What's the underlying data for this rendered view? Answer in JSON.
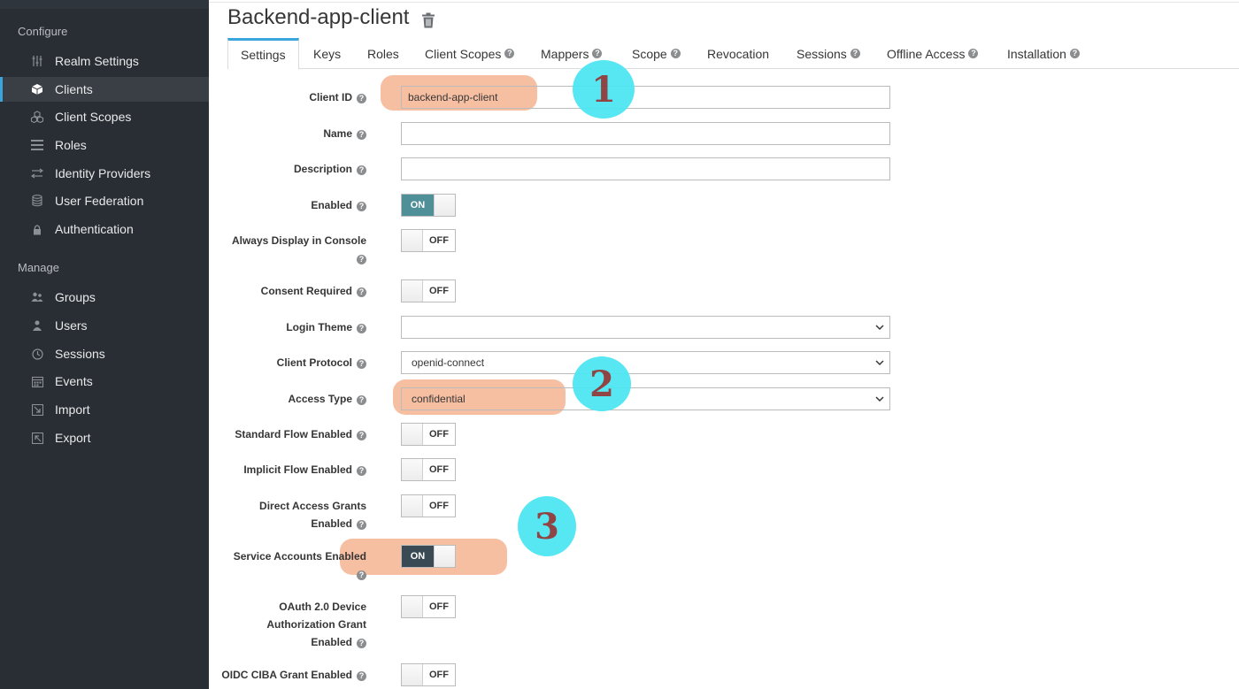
{
  "sidebar": {
    "configure_label": "Configure",
    "manage_label": "Manage",
    "configure_items": [
      {
        "label": "Realm Settings",
        "icon": "sliders-icon"
      },
      {
        "label": "Clients",
        "icon": "cube-icon"
      },
      {
        "label": "Client Scopes",
        "icon": "cubes-icon"
      },
      {
        "label": "Roles",
        "icon": "list-icon"
      },
      {
        "label": "Identity Providers",
        "icon": "exchange-icon"
      },
      {
        "label": "User Federation",
        "icon": "database-icon"
      },
      {
        "label": "Authentication",
        "icon": "lock-icon"
      }
    ],
    "manage_items": [
      {
        "label": "Groups",
        "icon": "users-icon"
      },
      {
        "label": "Users",
        "icon": "user-icon"
      },
      {
        "label": "Sessions",
        "icon": "clock-icon"
      },
      {
        "label": "Events",
        "icon": "calendar-icon"
      },
      {
        "label": "Import",
        "icon": "import-icon"
      },
      {
        "label": "Export",
        "icon": "export-icon"
      }
    ],
    "active_item": "Clients"
  },
  "header": {
    "title": "Backend-app-client"
  },
  "tabs": [
    {
      "label": "Settings",
      "help": false,
      "active": true
    },
    {
      "label": "Keys",
      "help": false
    },
    {
      "label": "Roles",
      "help": false
    },
    {
      "label": "Client Scopes",
      "help": true
    },
    {
      "label": "Mappers",
      "help": true
    },
    {
      "label": "Scope",
      "help": true
    },
    {
      "label": "Revocation",
      "help": false
    },
    {
      "label": "Sessions",
      "help": true
    },
    {
      "label": "Offline Access",
      "help": true
    },
    {
      "label": "Installation",
      "help": true
    }
  ],
  "form": {
    "client_id": {
      "label": "Client ID",
      "value": "backend-app-client"
    },
    "name": {
      "label": "Name",
      "value": ""
    },
    "description": {
      "label": "Description",
      "value": ""
    },
    "enabled": {
      "label": "Enabled",
      "state": "ON"
    },
    "always_display": {
      "label_line1": "Always Display in Console",
      "state": "OFF"
    },
    "consent_required": {
      "label": "Consent Required",
      "state": "OFF"
    },
    "login_theme": {
      "label": "Login Theme",
      "value": ""
    },
    "client_protocol": {
      "label": "Client Protocol",
      "value": "openid-connect"
    },
    "access_type": {
      "label": "Access Type",
      "value": "confidential"
    },
    "standard_flow": {
      "label": "Standard Flow Enabled",
      "state": "OFF"
    },
    "implicit_flow": {
      "label": "Implicit Flow Enabled",
      "state": "OFF"
    },
    "direct_access": {
      "label_line1": "Direct Access Grants",
      "label_line2": "Enabled",
      "state": "OFF"
    },
    "service_accounts": {
      "label_line1": "Service Accounts Enabled",
      "state": "ON"
    },
    "oauth_device": {
      "label_line1": "OAuth 2.0 Device",
      "label_line2": "Authorization Grant",
      "label_line3": "Enabled",
      "state": "OFF"
    },
    "oidc_ciba": {
      "label": "OIDC CIBA Grant Enabled",
      "state": "OFF"
    }
  },
  "annotations": {
    "marker1": "1",
    "marker2": "2",
    "marker3": "3",
    "highlight_color": "#f4a983",
    "marker_color": "#4ee6f2"
  },
  "colors": {
    "sidebar_bg": "#292e34",
    "accent": "#39a5dc",
    "toggle_on": "#0088ce"
  }
}
